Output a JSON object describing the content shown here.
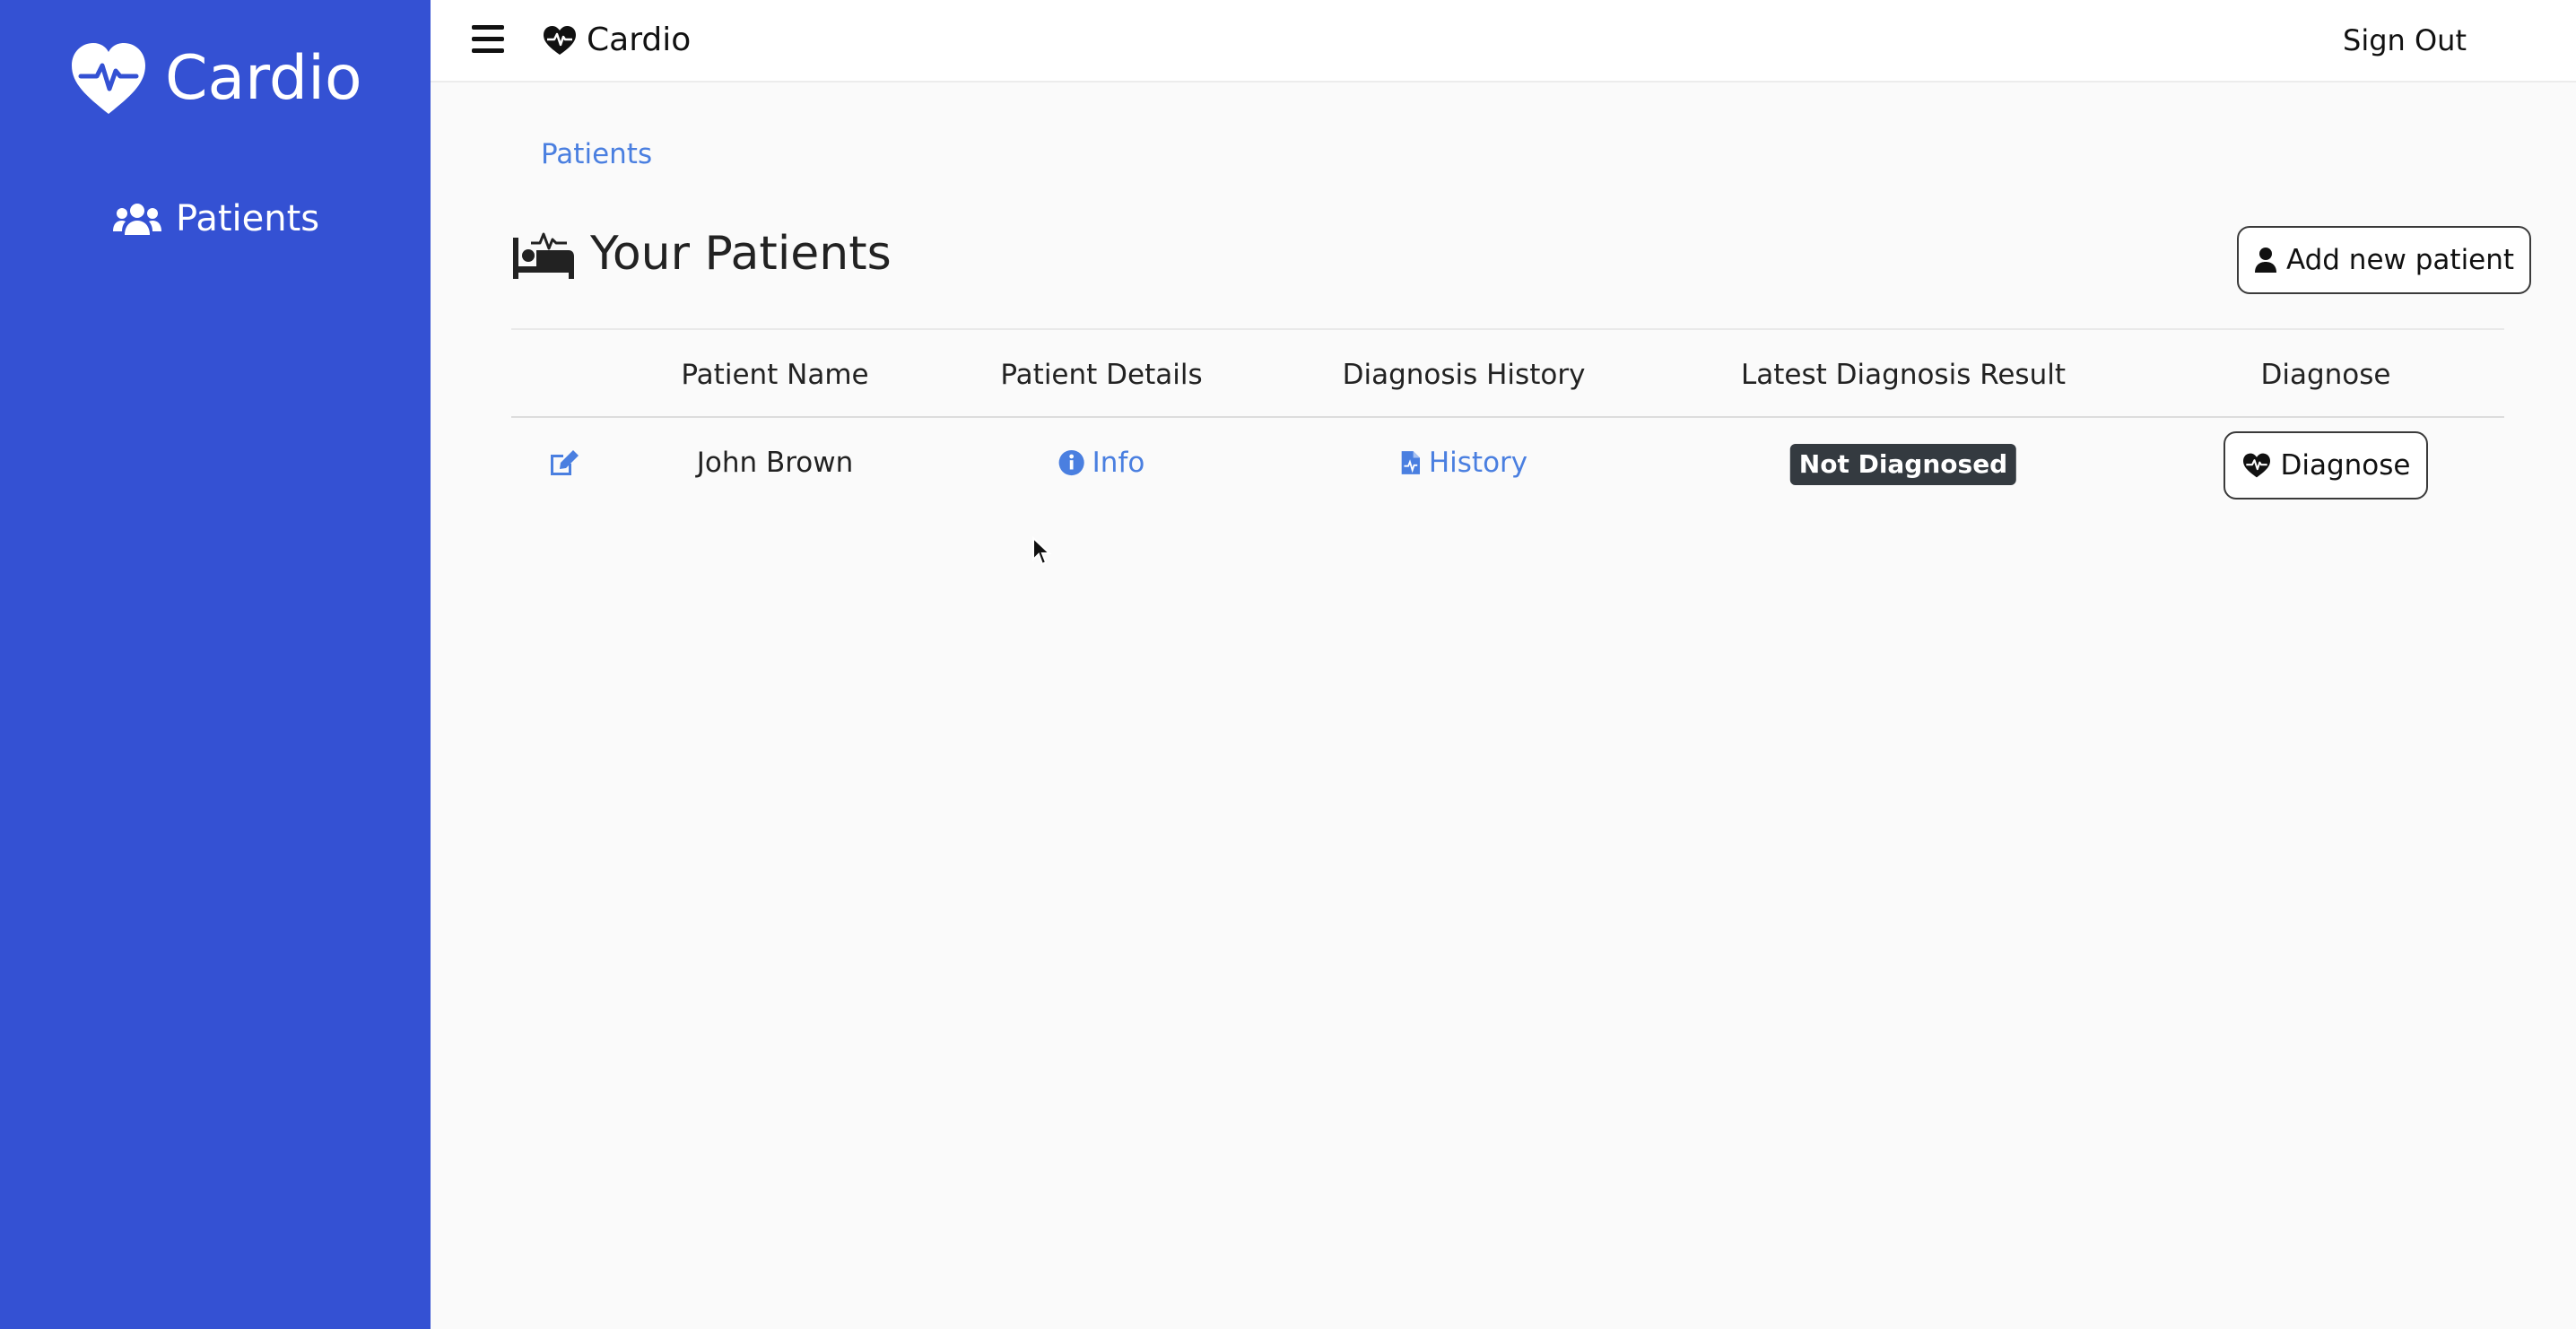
{
  "sidebar": {
    "brand": "Cardio",
    "nav": [
      {
        "label": "Patients",
        "icon": "users-icon"
      }
    ]
  },
  "topbar": {
    "menu_icon": "hamburger-icon",
    "brand": "Cardio",
    "sign_out": "Sign Out"
  },
  "breadcrumb": {
    "current": "Patients"
  },
  "page": {
    "title": "Your Patients",
    "title_icon": "bed-pulse-icon",
    "add_button": "Add new patient"
  },
  "table": {
    "columns": [
      "Patient Name",
      "Patient Details",
      "Diagnosis History",
      "Latest Diagnosis Result",
      "Diagnose"
    ],
    "rows": [
      {
        "edit_icon": "edit-icon",
        "name": "John Brown",
        "details_link": "Info",
        "history_link": "History",
        "result": "Not Diagnosed",
        "diagnose_button": "Diagnose"
      }
    ]
  },
  "colors": {
    "sidebar_bg": "#3451d3",
    "link": "#4a7fe0",
    "badge_bg": "#343a40"
  }
}
